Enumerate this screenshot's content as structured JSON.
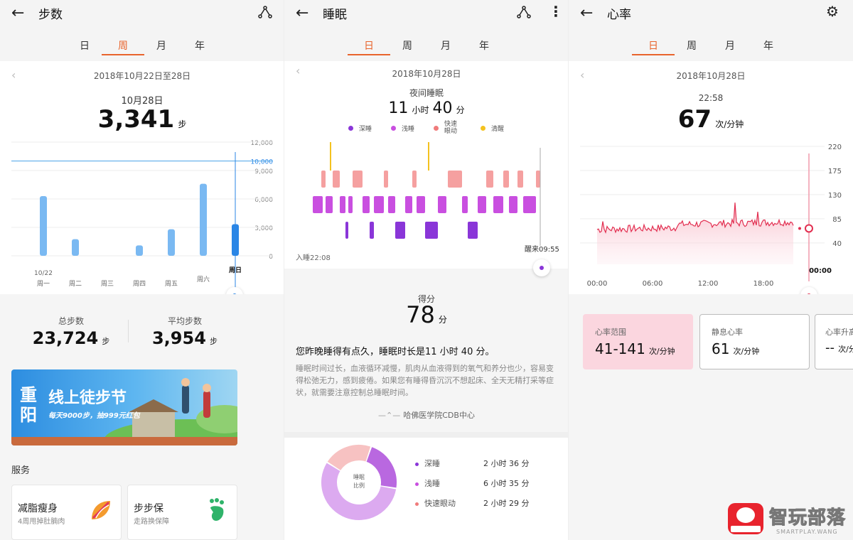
{
  "steps": {
    "title": "步数",
    "tabs": [
      "日",
      "周",
      "月",
      "年"
    ],
    "date_range": "2018年10月22日至28日",
    "selected_date": "10月28日",
    "value": "3,341",
    "unit": "步",
    "total_label": "总步数",
    "total_value": "23,724",
    "avg_label": "平均步数",
    "avg_value": "3,954",
    "banner": {
      "line1": "重阳",
      "line2": "线上徒步节",
      "line3": "每天9000步，抽999元红包"
    },
    "services_title": "服务",
    "services": [
      {
        "title": "减脂瘦身",
        "sub": "4周甩掉肚腩肉"
      },
      {
        "title": "步步保",
        "sub": "走路换保障"
      }
    ]
  },
  "steps_chart": {
    "type": "bar",
    "categories": [
      "周一",
      "周二",
      "周三",
      "周四",
      "周五",
      "周六",
      "周日"
    ],
    "date_label": "10/22",
    "values": [
      6300,
      1750,
      0,
      1100,
      2800,
      7600,
      3341
    ],
    "ylim": [
      0,
      12000
    ],
    "yticks": [
      "12,000",
      "10,000",
      "9,000",
      "6,000",
      "3,000",
      "0"
    ],
    "goal": 10000,
    "bar_color": "#7ab9f2",
    "highlight_color": "#2a86e6"
  },
  "sleep": {
    "title": "睡眠",
    "tabs": [
      "日",
      "周",
      "月",
      "年"
    ],
    "date": "2018年10月28日",
    "label": "夜间睡眠",
    "hours": "11",
    "hours_unit": "小时",
    "minutes": "40",
    "minutes_unit": "分",
    "legend": [
      {
        "name": "深睡",
        "color": "#8a36d8"
      },
      {
        "name": "浅睡",
        "color": "#c94fe0"
      },
      {
        "name": "快速\n眼动",
        "color": "#f07b7b"
      },
      {
        "name": "清醒",
        "color": "#f4c21f"
      }
    ],
    "start_label": "入睡22:08",
    "end_label": "醒来09:55",
    "score_label": "得分",
    "score": "78",
    "score_unit": "分",
    "summary": "您昨晚睡得有点久，睡眠时长是11 小时 40 分。",
    "detail": "睡眠时间过长，血液循环减慢，肌肉从血液得到的氧气和养分也少，容易变得松弛无力，感到疲倦。如果您有睡得昏沉沉不想起床、全天无精打采等症状，就需要注意控制总睡眠时间。",
    "source": "哈佛医学院CDB中心",
    "donut_label": "睡眠\n比例",
    "breakdown": [
      {
        "name": "深睡",
        "value": "2 小时 36 分",
        "color": "#8a36d8"
      },
      {
        "name": "浅睡",
        "value": "6 小时 35 分",
        "color": "#c94fe0"
      },
      {
        "name": "快速眼动",
        "value": "2 小时 29 分",
        "color": "#f07b7b"
      }
    ]
  },
  "heart": {
    "title": "心率",
    "tabs": [
      "日",
      "周",
      "月",
      "年"
    ],
    "date": "2018年10月28日",
    "time": "22:58",
    "value": "67",
    "unit": "次/分钟",
    "xticks": [
      "00:00",
      "06:00",
      "12:00",
      "18:00"
    ],
    "yticks": [
      "220",
      "175",
      "130",
      "85",
      "40"
    ],
    "now_label": "00:00",
    "cards": [
      {
        "label": "心率范围",
        "value": "41-141",
        "unit": "次/分钟",
        "bg": "#fbd6df"
      },
      {
        "label": "静息心率",
        "value": "61",
        "unit": "次/分钟",
        "bg": "#ffffff"
      },
      {
        "label": "心率升高",
        "value": "--",
        "unit": "次/分",
        "bg": "#ffffff"
      }
    ]
  },
  "watermark": {
    "name": "智玩部落",
    "url": "SMARTPLAY.WANG"
  }
}
